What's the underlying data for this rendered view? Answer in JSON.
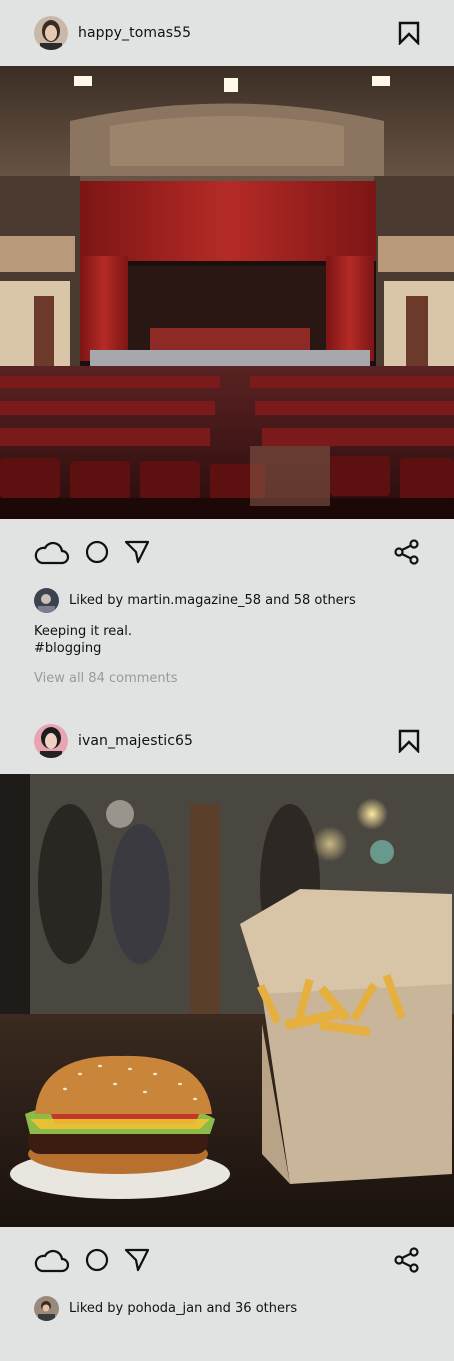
{
  "posts": [
    {
      "username": "happy_tomas55",
      "photo_subject": "theater-auditorium",
      "liked_by_user": "martin.magazine_58",
      "likes_text": "Liked by martin.magazine_58 and 58 others",
      "caption_line1": "Keeping it real.",
      "caption_line2": "#blogging",
      "comments_link": "View all 84 comments"
    },
    {
      "username": "ivan_majestic65",
      "photo_subject": "burger-and-fries",
      "liked_by_user": "pohoda_jan",
      "likes_text": "Liked by pohoda_jan and 36 others"
    }
  ],
  "icons": {
    "like": "cloud-icon",
    "comment": "circle-comment-icon",
    "send": "send-arrow-icon",
    "share": "share-icon",
    "save": "bookmark-icon"
  },
  "colors": {
    "background": "#e1e3e3",
    "text": "#111111",
    "muted": "#999999"
  }
}
